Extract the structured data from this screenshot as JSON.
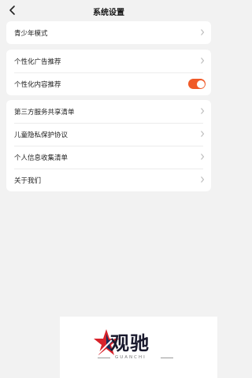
{
  "header": {
    "title": "系统设置",
    "back_icon": "chevron-left-icon"
  },
  "groups": [
    {
      "items": [
        {
          "label": "青少年模式",
          "control": "chevron"
        }
      ]
    },
    {
      "items": [
        {
          "label": "个性化广告推荐",
          "control": "chevron"
        },
        {
          "label": "个性化内容推荐",
          "control": "toggle",
          "toggle_on": true
        }
      ]
    },
    {
      "items": [
        {
          "label": "第三方服务共享清单",
          "control": "chevron"
        },
        {
          "label": "儿童隐私保护协议",
          "control": "chevron"
        },
        {
          "label": "个人信息收集清单",
          "control": "chevron"
        },
        {
          "label": "关于我们",
          "control": "chevron"
        }
      ]
    }
  ],
  "watermark": {
    "text": "观驰",
    "subtext": "GUANCHI"
  },
  "colors": {
    "background": "#f2f2f2",
    "accent": "#f05a28",
    "chevron": "#bbbbbb"
  }
}
